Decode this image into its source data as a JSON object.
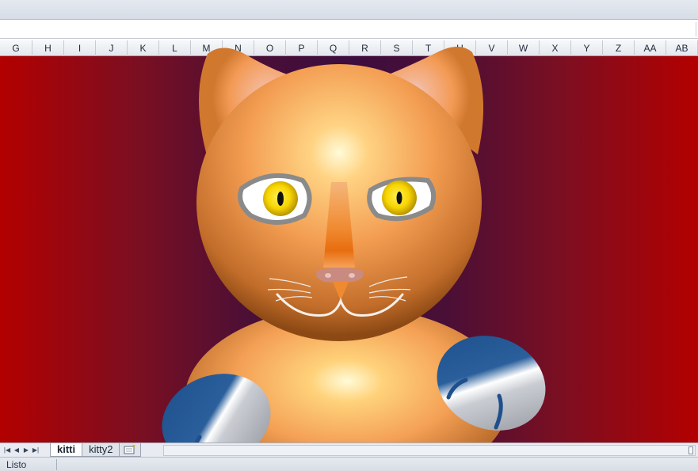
{
  "columns": [
    "G",
    "H",
    "I",
    "J",
    "K",
    "L",
    "M",
    "N",
    "O",
    "P",
    "Q",
    "R",
    "S",
    "T",
    "U",
    "V",
    "W",
    "X",
    "Y",
    "Z",
    "AA",
    "AB"
  ],
  "sheet_tabs": [
    {
      "label": "kitti",
      "active": true
    },
    {
      "label": "kitty2",
      "active": false
    }
  ],
  "status": {
    "text": "Listo"
  },
  "colors": {
    "background_edge": "#b30000",
    "background_center": "#3c0d3e",
    "fur": "#f3a05a",
    "eye_iris": "#f5d400",
    "mitten_blue": "#1f4f8c"
  },
  "icons": {
    "nav_first": "first-sheet-icon",
    "nav_prev": "prev-sheet-icon",
    "nav_next": "next-sheet-icon",
    "nav_last": "last-sheet-icon",
    "new_sheet": "insert-sheet-icon"
  }
}
